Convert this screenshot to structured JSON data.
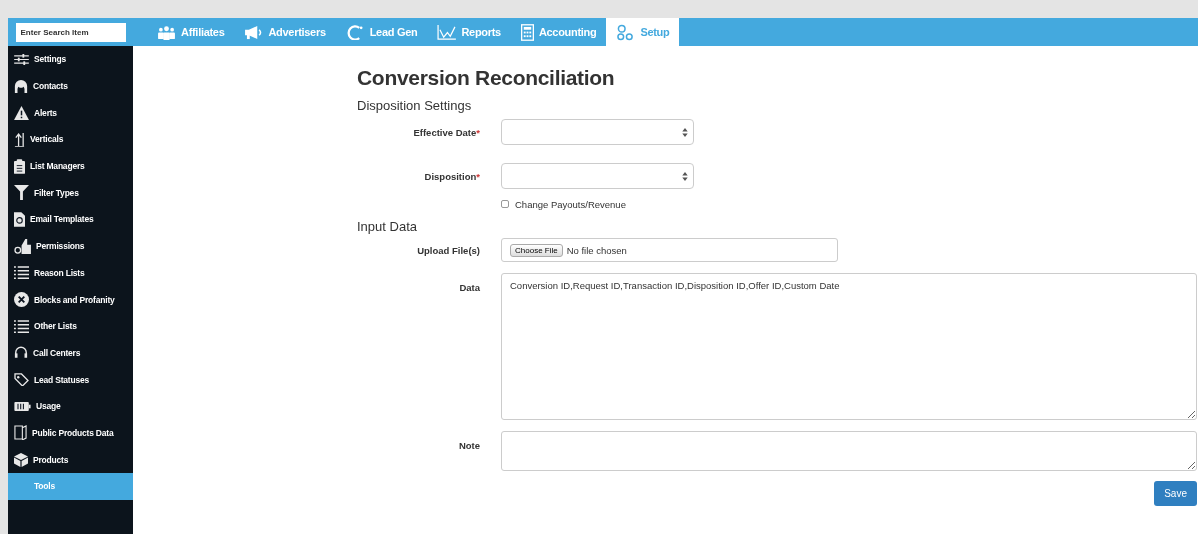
{
  "search": {
    "placeholder": "Enter Search Item"
  },
  "nav_tabs": [
    {
      "label": "Affiliates",
      "selected": false
    },
    {
      "label": "Advertisers",
      "selected": false
    },
    {
      "label": "Lead Gen",
      "selected": false
    },
    {
      "label": "Reports",
      "selected": false
    },
    {
      "label": "Accounting",
      "selected": false
    },
    {
      "label": "Setup",
      "selected": true
    }
  ],
  "sidebar": {
    "items": [
      {
        "label": "Settings",
        "selected": false
      },
      {
        "label": "Contacts",
        "selected": false
      },
      {
        "label": "Alerts",
        "selected": false
      },
      {
        "label": "Verticals",
        "selected": false
      },
      {
        "label": "List Managers",
        "selected": false
      },
      {
        "label": "Filter Types",
        "selected": false
      },
      {
        "label": "Email Templates",
        "selected": false
      },
      {
        "label": "Permissions",
        "selected": false
      },
      {
        "label": "Reason Lists",
        "selected": false
      },
      {
        "label": "Blocks and Profanity",
        "selected": false
      },
      {
        "label": "Other Lists",
        "selected": false
      },
      {
        "label": "Call Centers",
        "selected": false
      },
      {
        "label": "Lead Statuses",
        "selected": false
      },
      {
        "label": "Usage",
        "selected": false
      },
      {
        "label": "Public Products Data",
        "selected": false
      },
      {
        "label": "Products",
        "selected": false
      },
      {
        "label": "Tools",
        "selected": true
      }
    ]
  },
  "page": {
    "title": "Conversion Reconciliation",
    "sections": [
      {
        "heading": "Disposition Settings",
        "fields": [
          {
            "kind": "select",
            "label": "Effective Date",
            "required_mark": "*"
          },
          {
            "kind": "select",
            "label": "Disposition",
            "required_mark": "*"
          },
          {
            "kind": "checkbox",
            "label": "Change Payouts/Revenue",
            "checked": false
          }
        ]
      },
      {
        "heading": "Input Data",
        "fields": [
          {
            "kind": "file",
            "label": "Upload File(s)",
            "button": "Choose File",
            "status": "No file chosen"
          },
          {
            "kind": "textarea",
            "label": "Data",
            "value": "Conversion ID,Request ID,Transaction ID,Disposition ID,Offer ID,Custom Date"
          },
          {
            "kind": "textbox",
            "label": "Note"
          }
        ]
      }
    ],
    "save_button": "Save"
  }
}
